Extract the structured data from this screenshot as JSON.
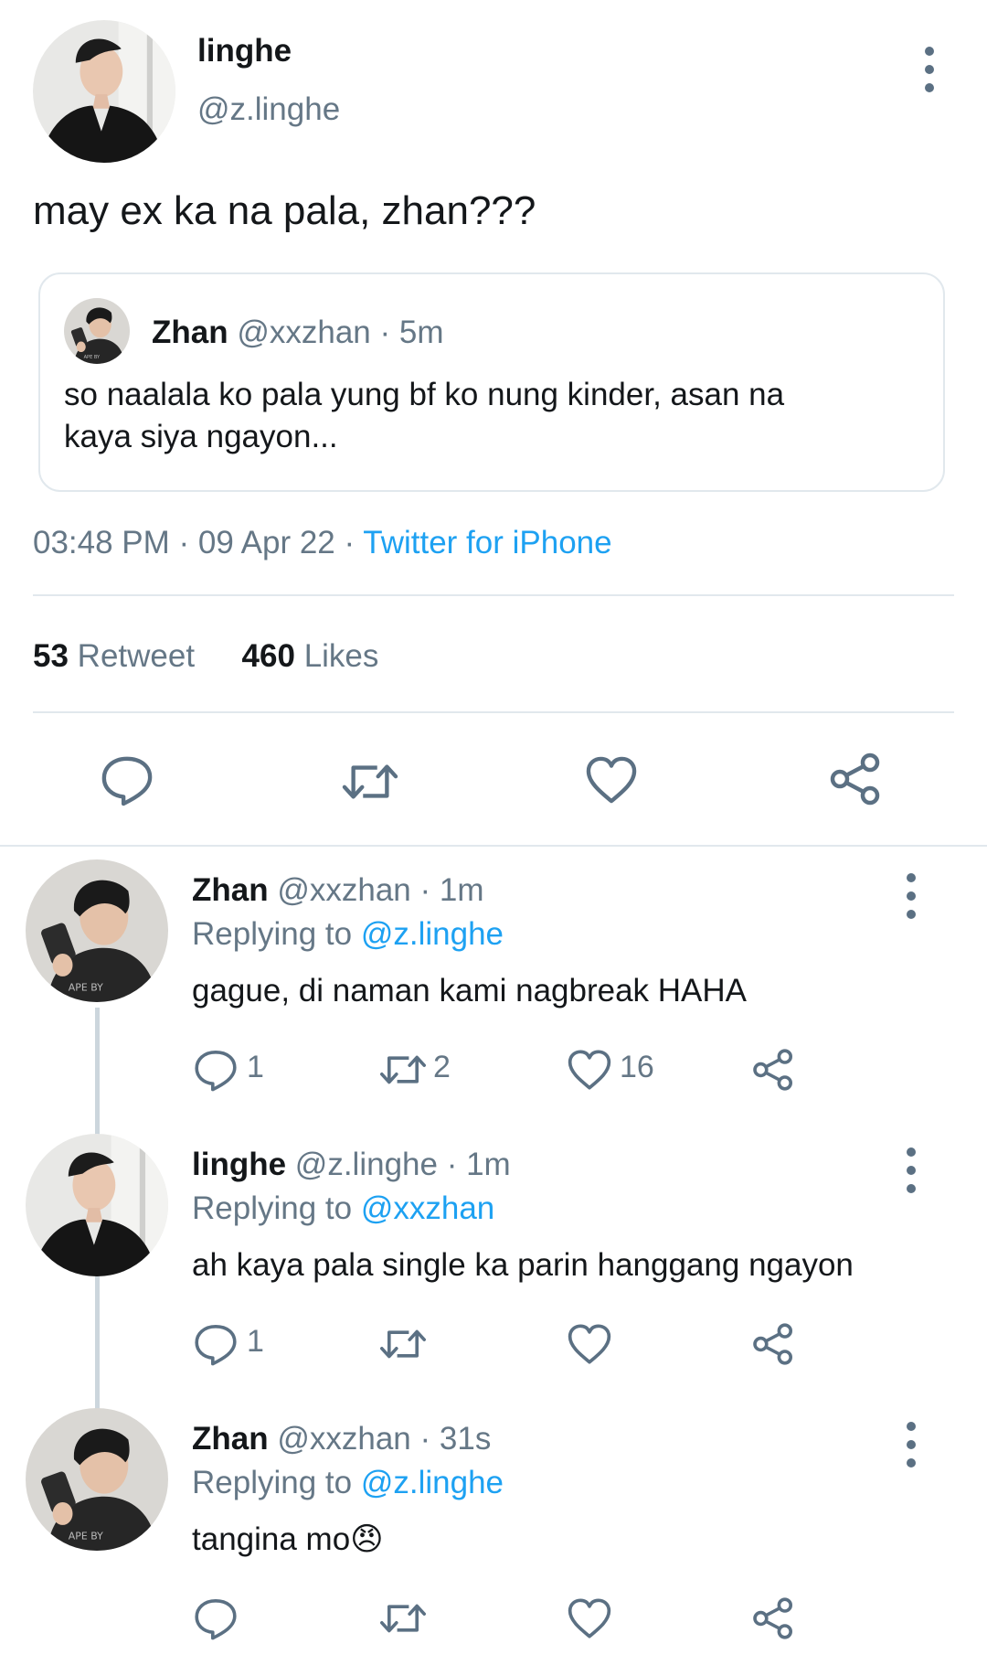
{
  "main_tweet": {
    "name": "linghe",
    "handle": "@z.linghe",
    "text": "may ex ka na pala, zhan???",
    "quoted": {
      "name": "Zhan",
      "handle": "@xxzhan",
      "time": "· 5m",
      "text_line1": "so naalala ko pala yung bf ko nung kinder, asan na",
      "text_line2": "kaya siya ngayon..."
    },
    "time": "03:48 PM",
    "date": "· 09 Apr 22 ·",
    "source": "Twitter for iPhone",
    "retweets_count": "53",
    "retweets_label": "Retweet",
    "likes_count": "460",
    "likes_label": "Likes"
  },
  "replies": [
    {
      "name": "Zhan",
      "handle": "@xxzhan",
      "time": "· 1m",
      "replying_label": "Replying to",
      "replying_to": "@z.linghe",
      "text": "gague, di naman kami nagbreak HAHA",
      "reply_count": "1",
      "retweet_count": "2",
      "like_count": "16"
    },
    {
      "name": "linghe",
      "handle": "@z.linghe",
      "time": "· 1m",
      "replying_label": "Replying to",
      "replying_to": "@xxzhan",
      "text": "ah kaya pala single ka parin hanggang ngayon",
      "reply_count": "1",
      "retweet_count": "",
      "like_count": ""
    },
    {
      "name": "Zhan",
      "handle": "@xxzhan",
      "time": "· 31s",
      "replying_label": "Replying to",
      "replying_to": "@z.linghe",
      "text": "tangina mo",
      "emoji": "😠",
      "reply_count": "",
      "retweet_count": "",
      "like_count": ""
    }
  ],
  "icons": [
    "more-vertical-icon",
    "reply-icon",
    "retweet-icon",
    "like-icon",
    "share-icon"
  ],
  "colors": {
    "link": "#1da1f2",
    "secondary": "#657786",
    "divider": "#e1e8ed",
    "icon": "#5b7083"
  }
}
